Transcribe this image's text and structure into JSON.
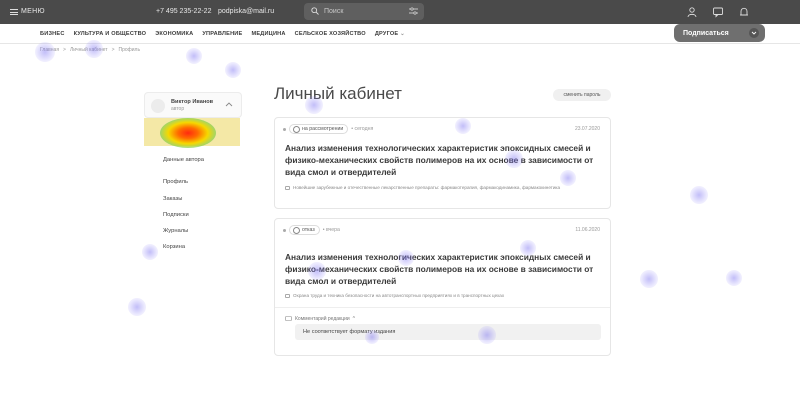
{
  "topbar": {
    "menu_label": "МЕНЮ",
    "phone": "+7 495 235-22-22",
    "email": "podpiska@mail.ru",
    "search_placeholder": "Поиск",
    "icons": [
      "user-icon",
      "chat-icon",
      "bell-icon"
    ]
  },
  "nav": {
    "items": [
      "БИЗНЕС",
      "КУЛЬТУРА И ОБЩЕСТВО",
      "ЭКОНОМИКА",
      "УПРАВЛЕНИЕ",
      "МЕДИЦИНА",
      "СЕЛЬСКОЕ ХОЗЯЙСТВО",
      "ДРУГОЕ"
    ],
    "subscribe_label": "Подписаться"
  },
  "breadcrumbs": [
    "Главная",
    ">",
    "Личный кабинет",
    ">",
    "Профиль"
  ],
  "sidebar": {
    "user_name": "Виктор Иванов",
    "user_role": "автор",
    "links": [
      "Данные автора",
      "Профиль",
      "Заказы",
      "Подписки",
      "Журналы",
      "Корзина"
    ]
  },
  "main": {
    "title": "Личный кабинет",
    "change_password": "сменить пароль",
    "cards": [
      {
        "status": "на рассмотрении",
        "when": "• сегодня",
        "date": "23.07.2020",
        "title": "Анализ изменения технологических характеристик эпоксидных смесей и физико-механических свойств полимеров на их основе в зависимости от вида смол и отвердителей",
        "tags": "Новейшие зарубежные и отечественные лекарственные препараты: фармакотерапия, фармакодинамика, фармакокинетика"
      },
      {
        "status": "отказ",
        "when": "• вчера",
        "date": "11.06.2020",
        "title": "Анализ изменения технологических характеристик эпоксидных смесей и физико-механических свойств полимеров на их основе в зависимости от вида смол и отвердителей",
        "tags": "Охрана труда и техника безопасности на автотранспортных предприятиях и в транспортных цехах",
        "comment_label": "Комментарий редакции",
        "comment_text": "Не соответствует формату издания"
      }
    ]
  },
  "colors": {
    "topbar": "#4a4a4a",
    "heat_hot": "#ff2a10",
    "heat_cold": "#7b6ff0"
  }
}
